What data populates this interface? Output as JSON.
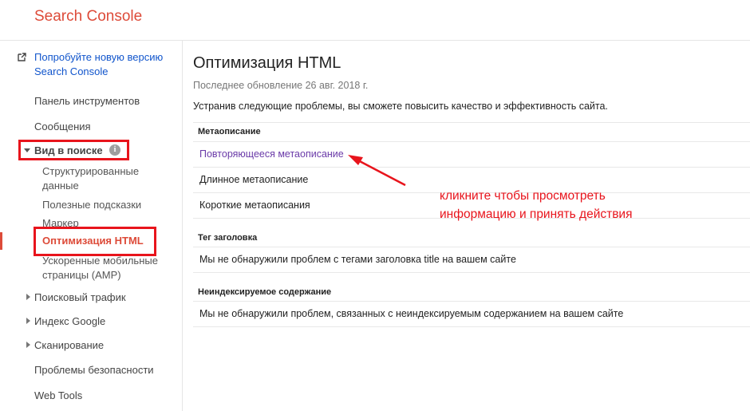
{
  "app": {
    "title": "Search Console"
  },
  "sidebar": {
    "try_new": [
      "Попробуйте новую версию",
      "Search Console"
    ],
    "dashboard": "Панель инструментов",
    "messages": "Сообщения",
    "search_appearance": "Вид в поиске",
    "structured_data": [
      "Структурированные",
      "данные"
    ],
    "data_highlighter": "Полезные подсказки",
    "marker": "Маркер",
    "html_improvements": "Оптимизация HTML",
    "amp": [
      "Ускоренные мобильные",
      "страницы (AMP)"
    ],
    "search_traffic": "Поисковый трафик",
    "google_index": "Индекс Google",
    "crawl": "Сканирование",
    "security_issues": "Проблемы безопасности",
    "web_tools": "Web Tools"
  },
  "main": {
    "title": "Оптимизация HTML",
    "last_updated": "Последнее обновление 26 авг. 2018 г.",
    "description": "Устранив следующие проблемы, вы сможете повысить качество и эффективность сайта.",
    "sections": [
      {
        "heading": "Метаописание",
        "rows": [
          "Повторяющееся метаописание",
          "Длинное метаописание",
          "Короткие метаописания"
        ]
      },
      {
        "heading": "Тег заголовка",
        "rows": [
          "Мы не обнаружили проблем с тегами заголовка title на вашем сайте"
        ]
      },
      {
        "heading": "Неиндексируемое содержание",
        "rows": [
          "Мы не обнаружили проблем, связанных с неиндексируемым содержанием на вашем сайте"
        ]
      }
    ]
  },
  "annotation": {
    "callout": [
      "кликните чтобы просмотреть",
      "информацию и принять действия"
    ]
  },
  "icons": {
    "external_link": "external-link-icon",
    "info": "info-icon",
    "expand": "chevron-right-icon",
    "collapse": "chevron-down-icon"
  },
  "colors": {
    "brand": "#dd4b39",
    "link": "#1155cc",
    "visited_link": "#6a3aa8",
    "annotation": "#e8141c"
  }
}
